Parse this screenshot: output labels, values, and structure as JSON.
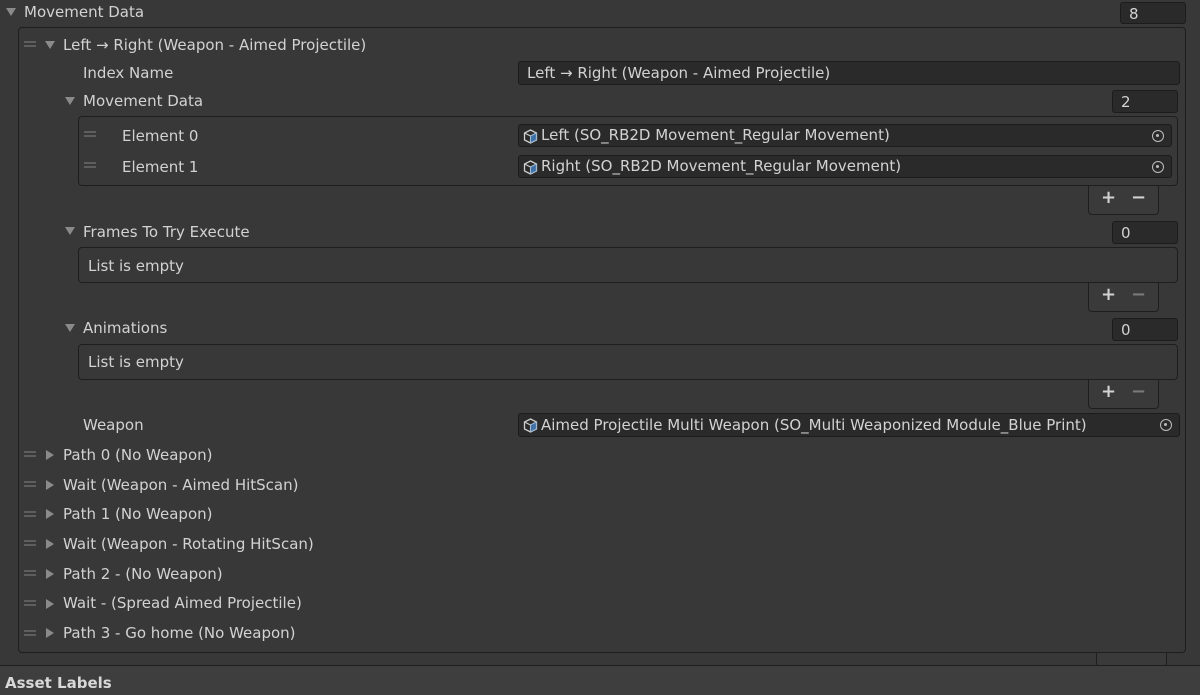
{
  "root": {
    "label": "Movement Data",
    "size": "8"
  },
  "entry": {
    "label": "Left → Right (Weapon - Aimed Projectile)",
    "index_name_label": "Index Name",
    "index_name_value": "Left → Right (Weapon - Aimed Projectile)",
    "movement": {
      "label": "Movement Data",
      "size": "2",
      "elements": [
        {
          "label": "Element 0",
          "value": "Left (SO_RB2D Movement_Regular Movement)"
        },
        {
          "label": "Element 1",
          "value": "Right (SO_RB2D Movement_Regular Movement)"
        }
      ]
    },
    "frames": {
      "label": "Frames To Try Execute",
      "size": "0",
      "empty_text": "List is empty"
    },
    "animations": {
      "label": "Animations",
      "size": "0",
      "empty_text": "List is empty"
    },
    "weapon": {
      "label": "Weapon",
      "value": "Aimed Projectile Multi Weapon (SO_Multi Weaponized Module_Blue Print)"
    }
  },
  "collapsed_items": [
    "Path 0 (No Weapon)",
    "Wait (Weapon - Aimed HitScan)",
    "Path 1 (No Weapon)",
    "Wait (Weapon - Rotating HitScan)",
    "Path 2 - (No Weapon)",
    "Wait - (Spread Aimed Projectile)",
    "Path 3 - Go home (No Weapon)"
  ],
  "list_buttons": {
    "add": "+",
    "remove": "−"
  },
  "footer": {
    "title": "Asset Labels"
  },
  "icons": {
    "foldout_open": "triangle-down",
    "foldout_closed": "triangle-right",
    "drag": "drag-handle",
    "object": "scriptable-object-cube",
    "picker": "object-picker"
  }
}
